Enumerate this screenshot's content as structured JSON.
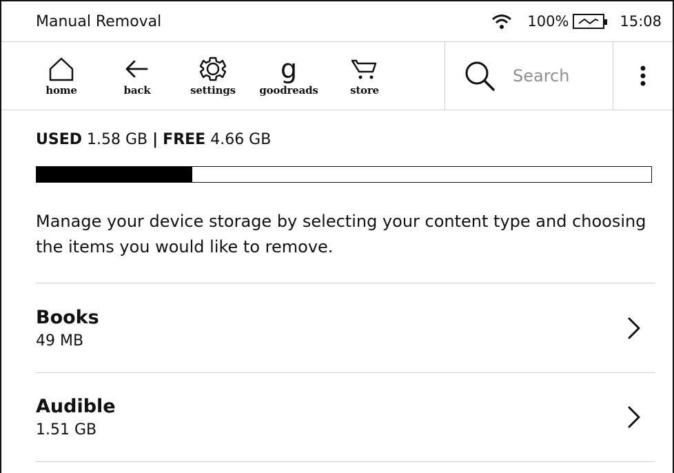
{
  "status": {
    "title": "Manual Removal",
    "battery": "100%",
    "time": "15:08"
  },
  "toolbar": {
    "home_label": "home",
    "back_label": "back",
    "settings_label": "settings",
    "goodreads_glyph": "g",
    "goodreads_label": "goodreads",
    "store_label": "store",
    "search_placeholder": "Search"
  },
  "storage": {
    "used_label": "USED",
    "used_value": "1.58 GB",
    "separator": "|",
    "free_label": "FREE",
    "free_value": "4.66 GB",
    "used_fraction": 0.253,
    "description": "Manage your device storage by selecting your content type and choosing the items you would like to remove."
  },
  "content_types": [
    {
      "name": "Books",
      "size": "49 MB"
    },
    {
      "name": "Audible",
      "size": "1.51 GB"
    }
  ]
}
